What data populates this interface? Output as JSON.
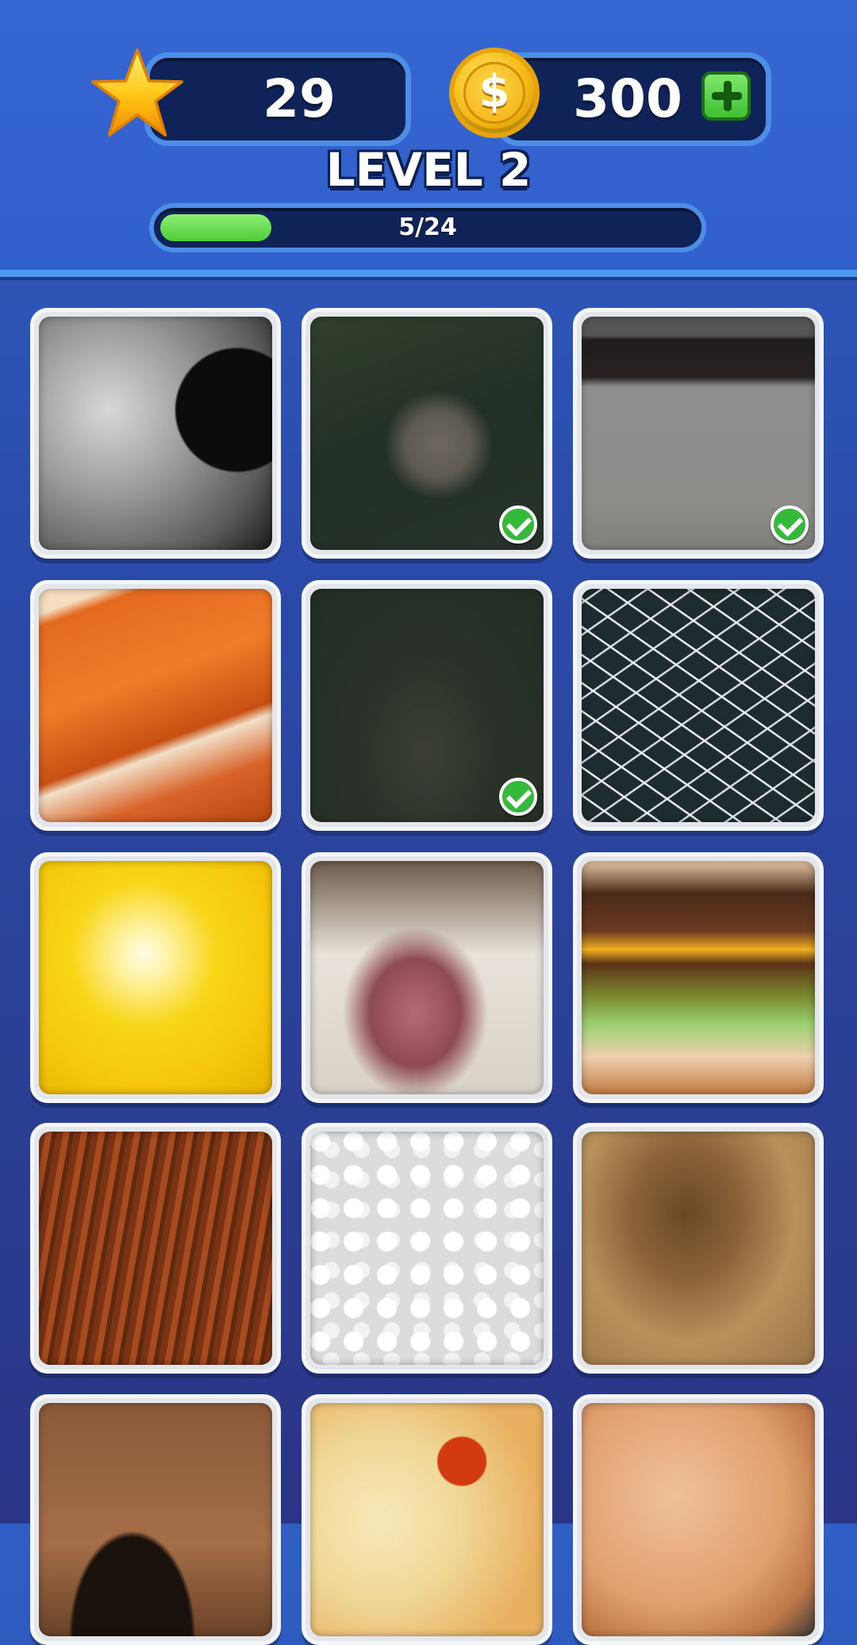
{
  "hud": {
    "stars": "29",
    "coins": "300",
    "coin_symbol": "$",
    "level_title": "LEVEL 2",
    "progress_text": "5/24",
    "progress_fraction": 0.208
  },
  "colors": {
    "accent_green": "#4fcc3a",
    "panel_dark": "#0f2358",
    "header_blue": "#3566d2"
  },
  "tiles": [
    {
      "subject": "moon",
      "found": false
    },
    {
      "subject": "rabbit",
      "found": true
    },
    {
      "subject": "cake",
      "found": true
    },
    {
      "subject": "carrot",
      "found": false
    },
    {
      "subject": "tree",
      "found": true
    },
    {
      "subject": "bicycle-wheel",
      "found": false
    },
    {
      "subject": "lemon",
      "found": false
    },
    {
      "subject": "dog-mouth",
      "found": false
    },
    {
      "subject": "burger",
      "found": false
    },
    {
      "subject": "horse-hair",
      "found": false
    },
    {
      "subject": "rice",
      "found": false
    },
    {
      "subject": "lion-fur",
      "found": false
    },
    {
      "subject": "guitar",
      "found": false
    },
    {
      "subject": "pizza",
      "found": false
    },
    {
      "subject": "egg",
      "found": false
    }
  ]
}
